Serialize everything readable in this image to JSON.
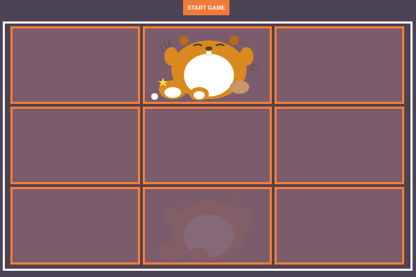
{
  "header": {
    "start_button_label": "START GAME"
  },
  "board": {
    "rows": 3,
    "cols": 3,
    "holes": [
      {
        "id": "hole-1",
        "state": "empty"
      },
      {
        "id": "hole-2",
        "state": "mole-up"
      },
      {
        "id": "hole-3",
        "state": "empty"
      },
      {
        "id": "hole-4",
        "state": "empty"
      },
      {
        "id": "hole-5",
        "state": "empty"
      },
      {
        "id": "hole-6",
        "state": "empty"
      },
      {
        "id": "hole-7",
        "state": "empty"
      },
      {
        "id": "hole-8",
        "state": "mole-faded"
      },
      {
        "id": "hole-9",
        "state": "empty"
      }
    ]
  },
  "colors": {
    "background": "#4d4357",
    "button": "#f07a3a",
    "board_border": "#ffffff",
    "hole_fill": "#7b5c6d",
    "hole_border": "#ff7f33",
    "mole_fur": "#d9891f",
    "mole_belly": "#ffffff"
  },
  "icons": {
    "mole": "mole-icon",
    "star": "star-icon"
  }
}
